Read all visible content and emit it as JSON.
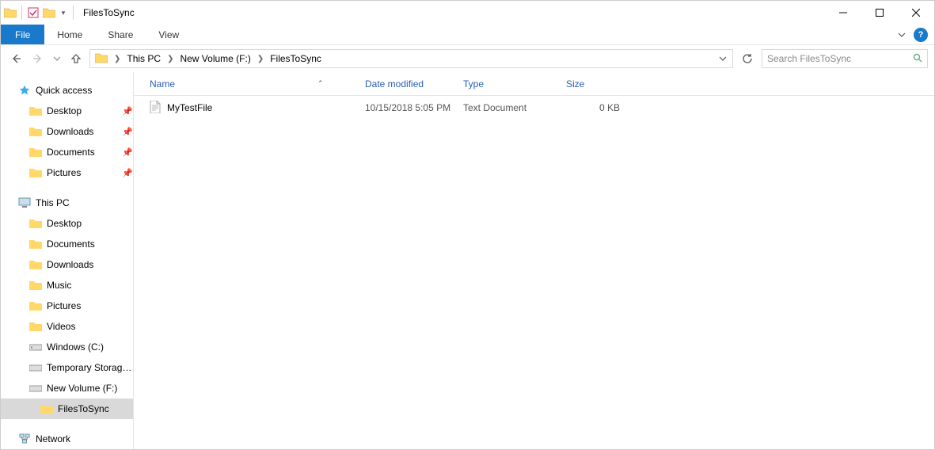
{
  "title": "FilesToSync",
  "ribbon": {
    "file": "File",
    "home": "Home",
    "share": "Share",
    "view": "View"
  },
  "breadcrumbs": [
    "This PC",
    "New Volume (F:)",
    "FilesToSync"
  ],
  "search_placeholder": "Search FilesToSync",
  "columns": {
    "name": "Name",
    "date": "Date modified",
    "type": "Type",
    "size": "Size"
  },
  "files": [
    {
      "name": "MyTestFile",
      "date": "10/15/2018 5:05 PM",
      "type": "Text Document",
      "size": "0 KB"
    }
  ],
  "sidebar": {
    "quick": "Quick access",
    "quick_items": [
      {
        "label": "Desktop"
      },
      {
        "label": "Downloads"
      },
      {
        "label": "Documents"
      },
      {
        "label": "Pictures"
      }
    ],
    "thispc": "This PC",
    "pc_items": [
      {
        "label": "Desktop"
      },
      {
        "label": "Documents"
      },
      {
        "label": "Downloads"
      },
      {
        "label": "Music"
      },
      {
        "label": "Pictures"
      },
      {
        "label": "Videos"
      },
      {
        "label": "Windows (C:)"
      },
      {
        "label": "Temporary Storage ("
      },
      {
        "label": "New Volume (F:)"
      }
    ],
    "selected": "FilesToSync",
    "network": "Network"
  }
}
